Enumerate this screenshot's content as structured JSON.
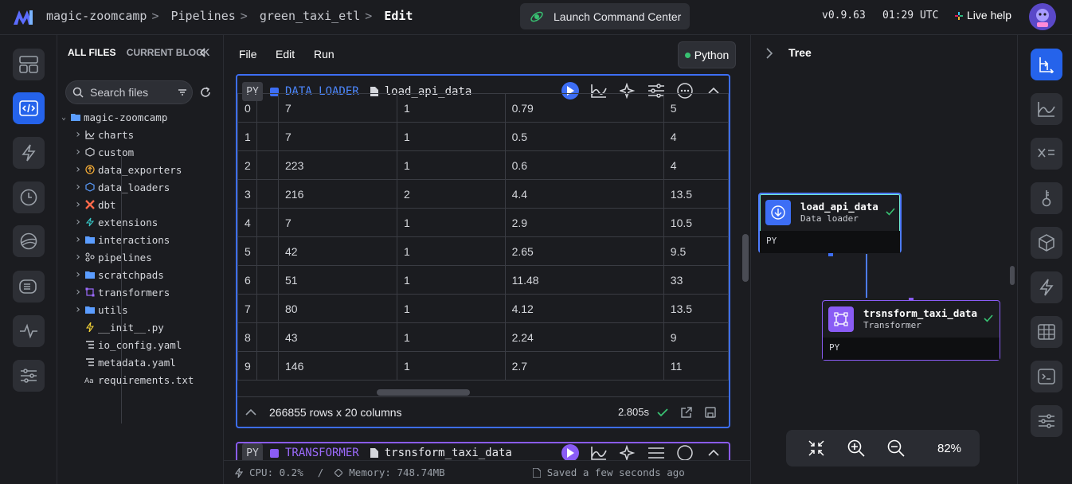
{
  "breadcrumb": {
    "project": "magic-zoomcamp",
    "section": "Pipelines",
    "pipeline": "green_taxi_etl",
    "page": "Edit"
  },
  "header": {
    "launch_label": "Launch Command Center",
    "version": "v0.9.63",
    "time": "01:29 UTC",
    "help_label": "Live help"
  },
  "files": {
    "tab_all": "ALL FILES",
    "tab_current": "CURRENT BLOCK",
    "search_placeholder": "Search files",
    "root": "magic-zoomcamp",
    "items": [
      {
        "name": "charts",
        "icon": "chart-icon",
        "folder": true
      },
      {
        "name": "custom",
        "icon": "cube-icon",
        "folder": true
      },
      {
        "name": "data_exporters",
        "icon": "exporter-icon",
        "folder": true
      },
      {
        "name": "data_loaders",
        "icon": "loader-icon",
        "folder": true
      },
      {
        "name": "dbt",
        "icon": "dbt-icon",
        "folder": true
      },
      {
        "name": "extensions",
        "icon": "extension-icon",
        "folder": true
      },
      {
        "name": "interactions",
        "icon": "folder-icon",
        "folder": true
      },
      {
        "name": "pipelines",
        "icon": "pipeline-icon",
        "folder": true
      },
      {
        "name": "scratchpads",
        "icon": "folder-icon",
        "folder": true
      },
      {
        "name": "transformers",
        "icon": "transformer-icon",
        "folder": true
      },
      {
        "name": "utils",
        "icon": "folder-icon",
        "folder": true
      },
      {
        "name": "__init__.py",
        "icon": "python-file-icon",
        "folder": false
      },
      {
        "name": "io_config.yaml",
        "icon": "yaml-file-icon",
        "folder": false
      },
      {
        "name": "metadata.yaml",
        "icon": "yaml-file-icon",
        "folder": false
      },
      {
        "name": "requirements.txt",
        "icon": "text-file-icon",
        "folder": false
      }
    ]
  },
  "menu": {
    "file": "File",
    "edit": "Edit",
    "run": "Run",
    "language": "Python"
  },
  "block1": {
    "lang": "PY",
    "type": "DATA LOADER",
    "name": "load_api_data",
    "rows": [
      [
        "0",
        "7",
        "1",
        "0.79",
        "5"
      ],
      [
        "1",
        "7",
        "1",
        "0.5",
        "4"
      ],
      [
        "2",
        "223",
        "1",
        "0.6",
        "4"
      ],
      [
        "3",
        "216",
        "2",
        "4.4",
        "13.5"
      ],
      [
        "4",
        "7",
        "1",
        "2.9",
        "10.5"
      ],
      [
        "5",
        "42",
        "1",
        "2.65",
        "9.5"
      ],
      [
        "6",
        "51",
        "1",
        "11.48",
        "33"
      ],
      [
        "7",
        "80",
        "1",
        "4.12",
        "13.5"
      ],
      [
        "8",
        "43",
        "1",
        "2.24",
        "9"
      ],
      [
        "9",
        "146",
        "1",
        "2.7",
        "11"
      ]
    ],
    "summary": "266855 rows x 20 columns",
    "duration": "2.805s"
  },
  "block2": {
    "lang": "PY",
    "type": "TRANSFORMER",
    "name": "trsnsform_taxi_data"
  },
  "status": {
    "cpu": "CPU: 0.2%",
    "sep": "/",
    "memory": "Memory: 748.74MB",
    "saved": "Saved a few seconds ago"
  },
  "tree": {
    "title": "Tree",
    "node1": {
      "name": "load_api_data",
      "type": "Data loader",
      "lang": "PY"
    },
    "node2": {
      "name": "trsnsform_taxi_data",
      "type": "Transformer",
      "lang": "PY"
    },
    "zoom": "82%"
  },
  "colors": {
    "accent": "#2563eb",
    "loader": "#3d6ef5",
    "transformer": "#8a5cf5",
    "success": "#38c172"
  }
}
